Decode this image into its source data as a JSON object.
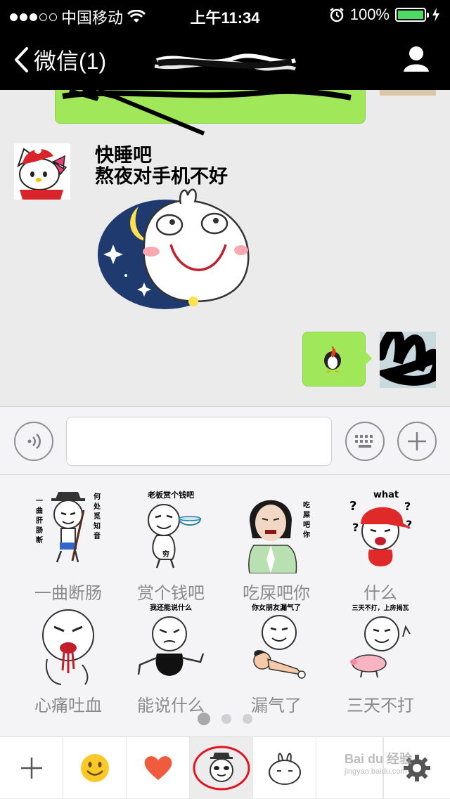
{
  "status_bar": {
    "carrier": "中国移动",
    "time": "上午11:34",
    "battery": "100%",
    "signal_icon": "signal-dots-icon",
    "wifi_icon": "wifi-icon",
    "alarm_icon": "alarm-icon",
    "charging_icon": "charging-bolt-icon"
  },
  "nav": {
    "back_label": "微信(1)",
    "back_icon": "chevron-left-icon",
    "profile_icon": "person-icon"
  },
  "chat": {
    "incoming_sticker_caption_line1": "快睡吧",
    "incoming_sticker_caption_line2": "熬夜对手机不好"
  },
  "input_bar": {
    "voice_icon": "voice-icon",
    "keyboard_icon": "keyboard-icon",
    "plus_icon": "plus-icon"
  },
  "stickers": [
    {
      "label": "一曲断肠",
      "text": [
        "一曲肝肠断",
        "何处觅知音"
      ]
    },
    {
      "label": "赏个钱吧",
      "text": [
        "老板赏个钱吧"
      ]
    },
    {
      "label": "吃屎吧你",
      "text": [
        "吃屎吧你"
      ]
    },
    {
      "label": "什么",
      "text": [
        "what"
      ]
    },
    {
      "label": "心痛吐血",
      "text": []
    },
    {
      "label": "能说什么",
      "text": [
        "我还能说什么"
      ]
    },
    {
      "label": "漏气了",
      "text": [
        "你女朋友漏气了"
      ]
    },
    {
      "label": "三天不打",
      "text": [
        "三天不打，上房揭瓦"
      ]
    }
  ],
  "pager": {
    "pages": 3,
    "current": 1
  },
  "tab_bar": {
    "tabs": [
      "plus-icon",
      "smiley-icon",
      "heart-icon",
      "panda-sticker-icon",
      "rabbit-sticker-icon"
    ],
    "selected": 3,
    "settings_icon": "gear-icon"
  },
  "watermark": {
    "main": "Bai du 经验",
    "sub": "jingyan.baidu.com"
  },
  "colors": {
    "bubble_green": "#a0e75a",
    "battery_green": "#4cd964",
    "heart": "#ef5b3c",
    "selection_circle": "#e0141e"
  }
}
